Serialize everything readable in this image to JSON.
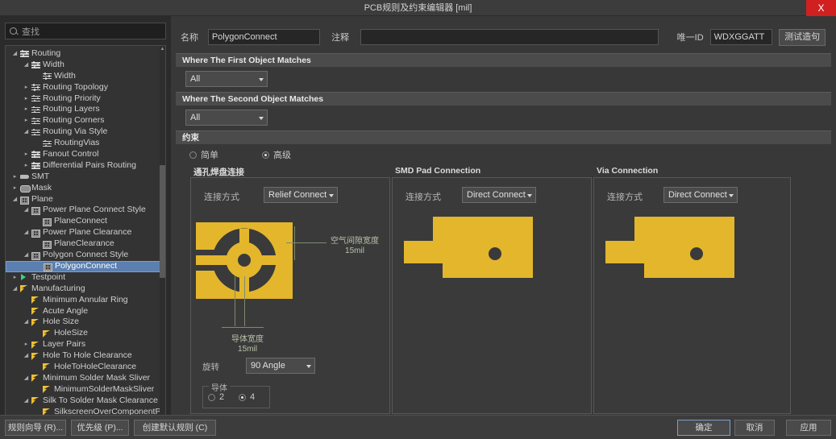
{
  "window": {
    "title": "PCB规则及约束编辑器 [mil]",
    "close_label": "X"
  },
  "sidebar": {
    "search": {
      "placeholder": "查找",
      "value": "查找",
      "icon": "search-icon"
    },
    "tree": [
      {
        "label": "Routing",
        "depth": 1,
        "twisty": "down",
        "icon": "route"
      },
      {
        "label": "Width",
        "depth": 2,
        "twisty": "down",
        "icon": "route"
      },
      {
        "label": "Width",
        "depth": 3,
        "twisty": "",
        "icon": "route"
      },
      {
        "label": "Routing Topology",
        "depth": 2,
        "twisty": "right",
        "icon": "route"
      },
      {
        "label": "Routing Priority",
        "depth": 2,
        "twisty": "right",
        "icon": "route"
      },
      {
        "label": "Routing Layers",
        "depth": 2,
        "twisty": "right",
        "icon": "route"
      },
      {
        "label": "Routing Corners",
        "depth": 2,
        "twisty": "right",
        "icon": "route"
      },
      {
        "label": "Routing Via Style",
        "depth": 2,
        "twisty": "down",
        "icon": "route"
      },
      {
        "label": "RoutingVias",
        "depth": 3,
        "twisty": "",
        "icon": "route"
      },
      {
        "label": "Fanout Control",
        "depth": 2,
        "twisty": "right",
        "icon": "route"
      },
      {
        "label": "Differential Pairs Routing",
        "depth": 2,
        "twisty": "right",
        "icon": "route"
      },
      {
        "label": "SMT",
        "depth": 1,
        "twisty": "right",
        "icon": "smt"
      },
      {
        "label": "Mask",
        "depth": 1,
        "twisty": "right",
        "icon": "mask"
      },
      {
        "label": "Plane",
        "depth": 1,
        "twisty": "down",
        "icon": "plane"
      },
      {
        "label": "Power Plane Connect Style",
        "depth": 2,
        "twisty": "down",
        "icon": "plane"
      },
      {
        "label": "PlaneConnect",
        "depth": 3,
        "twisty": "",
        "icon": "plane"
      },
      {
        "label": "Power Plane Clearance",
        "depth": 2,
        "twisty": "down",
        "icon": "plane"
      },
      {
        "label": "PlaneClearance",
        "depth": 3,
        "twisty": "",
        "icon": "plane"
      },
      {
        "label": "Polygon Connect Style",
        "depth": 2,
        "twisty": "down",
        "icon": "plane"
      },
      {
        "label": "PolygonConnect",
        "depth": 3,
        "twisty": "",
        "icon": "plane",
        "selected": true
      },
      {
        "label": "Testpoint",
        "depth": 1,
        "twisty": "right",
        "icon": "test"
      },
      {
        "label": "Manufacturing",
        "depth": 1,
        "twisty": "down",
        "icon": "mfg"
      },
      {
        "label": "Minimum Annular Ring",
        "depth": 2,
        "twisty": "",
        "icon": "mfg"
      },
      {
        "label": "Acute Angle",
        "depth": 2,
        "twisty": "",
        "icon": "mfg"
      },
      {
        "label": "Hole Size",
        "depth": 2,
        "twisty": "down",
        "icon": "mfg"
      },
      {
        "label": "HoleSize",
        "depth": 3,
        "twisty": "",
        "icon": "mfg"
      },
      {
        "label": "Layer Pairs",
        "depth": 2,
        "twisty": "right",
        "icon": "mfg"
      },
      {
        "label": "Hole To Hole Clearance",
        "depth": 2,
        "twisty": "down",
        "icon": "mfg"
      },
      {
        "label": "HoleToHoleClearance",
        "depth": 3,
        "twisty": "",
        "icon": "mfg"
      },
      {
        "label": "Minimum Solder Mask Sliver",
        "depth": 2,
        "twisty": "down",
        "icon": "mfg"
      },
      {
        "label": "MinimumSolderMaskSliver",
        "depth": 3,
        "twisty": "",
        "icon": "mfg"
      },
      {
        "label": "Silk To Solder Mask Clearance",
        "depth": 2,
        "twisty": "down",
        "icon": "mfg"
      },
      {
        "label": "SilkscreenOverComponentPad",
        "depth": 3,
        "twisty": "",
        "icon": "mfg"
      }
    ]
  },
  "header": {
    "name_label": "名称",
    "name_value": "PolygonConnect",
    "comment_label": "注释",
    "comment_value": "",
    "unique_id_label": "唯一ID",
    "unique_id_value": "WDXGGATT",
    "test_button": "测试造句"
  },
  "sections": {
    "first_match": {
      "title": "Where The First Object Matches",
      "scope_value": "All"
    },
    "second_match": {
      "title": "Where The Second Object Matches",
      "scope_value": "All"
    },
    "constraints": {
      "title": "约束",
      "mode_simple": "简单",
      "mode_advanced": "高级",
      "mode_selected": "advanced"
    }
  },
  "panels": {
    "through_hole": {
      "title": "通孔焊盘连接",
      "connect_label": "连接方式",
      "connect_value": "Relief Connect",
      "air_gap_label": "空气间隙宽度",
      "air_gap_value": "15mil",
      "conductor_width_label": "导体宽度",
      "conductor_width_value": "15mil",
      "angle_label": "旋转",
      "angle_value": "90 Angle",
      "conductors_group_label": "导体",
      "conductors_option_2": "2",
      "conductors_option_4": "4",
      "conductors_selected": "4"
    },
    "smd_pad": {
      "title": "SMD Pad Connection",
      "connect_label": "连接方式",
      "connect_value": "Direct Connect"
    },
    "via": {
      "title": "Via Connection",
      "connect_label": "连接方式",
      "connect_value": "Direct Connect"
    }
  },
  "footer": {
    "rule_wizard": "规则向导 (R)...",
    "priority": "优先级 (P)...",
    "create_default": "创建默认规则 (C)",
    "ok": "确定",
    "cancel": "取消",
    "apply": "应用"
  },
  "colors": {
    "pad_gold": "#e3b62c",
    "accent_blue": "#5a7fb0",
    "close_red": "#d02020"
  }
}
